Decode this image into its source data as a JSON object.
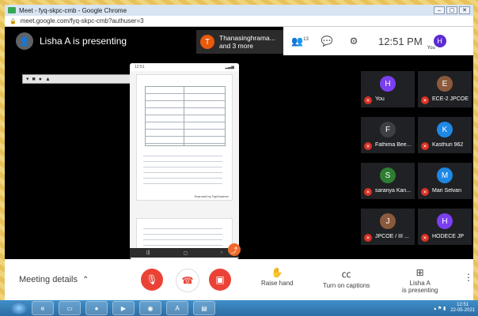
{
  "window": {
    "title": "Meet - fyq-skpc-cmb - Google Chrome",
    "controls": [
      "–",
      "▢",
      "✕"
    ]
  },
  "address": {
    "url": "meet.google.com/fyq-skpc-cmb?authuser=3"
  },
  "topbar": {
    "presenter_text": "Lisha A is presenting",
    "pinned_initial": "T",
    "pinned_name_line1": "Thanasinghrama...",
    "pinned_name_line2": "and 3 more",
    "participants_count": "13",
    "time": "12:51 PM",
    "you_initial": "H",
    "you_label": "You"
  },
  "phone": {
    "status_left": "12:51",
    "caption1": "Scanned by TapScanner",
    "caption2": "Scanned by TapScanner"
  },
  "tiles": [
    {
      "name": "You",
      "initial": "H",
      "color": "#7b3ff2"
    },
    {
      "name": "ECE-2 JPCOE",
      "initial": "E",
      "color": "#8b5a3c"
    },
    {
      "name": "Fathima Bee...",
      "initial": "F",
      "color": "#3c4043"
    },
    {
      "name": "Kasthuri 962",
      "initial": "K",
      "color": "#1e88e5"
    },
    {
      "name": "saranya Kan...",
      "initial": "S",
      "color": "#2e7d32"
    },
    {
      "name": "Mari Selvan",
      "initial": "M",
      "color": "#1e88e5"
    },
    {
      "name": "JPCOE / III ...",
      "initial": "J",
      "color": "#8b5a3c"
    },
    {
      "name": "HODECE JP",
      "initial": "H",
      "color": "#7b3ff2"
    }
  ],
  "bottombar": {
    "meeting_details": "Meeting details",
    "raise_hand": "Raise hand",
    "captions": "Turn on captions",
    "presenting_line1": "Lisha A",
    "presenting_line2": "is presenting"
  },
  "taskbar": {
    "clock_time": "12:51",
    "clock_date": "22-05-2021"
  },
  "colors": {
    "mute_red": "#ea4335",
    "accent": "#1a73e8"
  }
}
